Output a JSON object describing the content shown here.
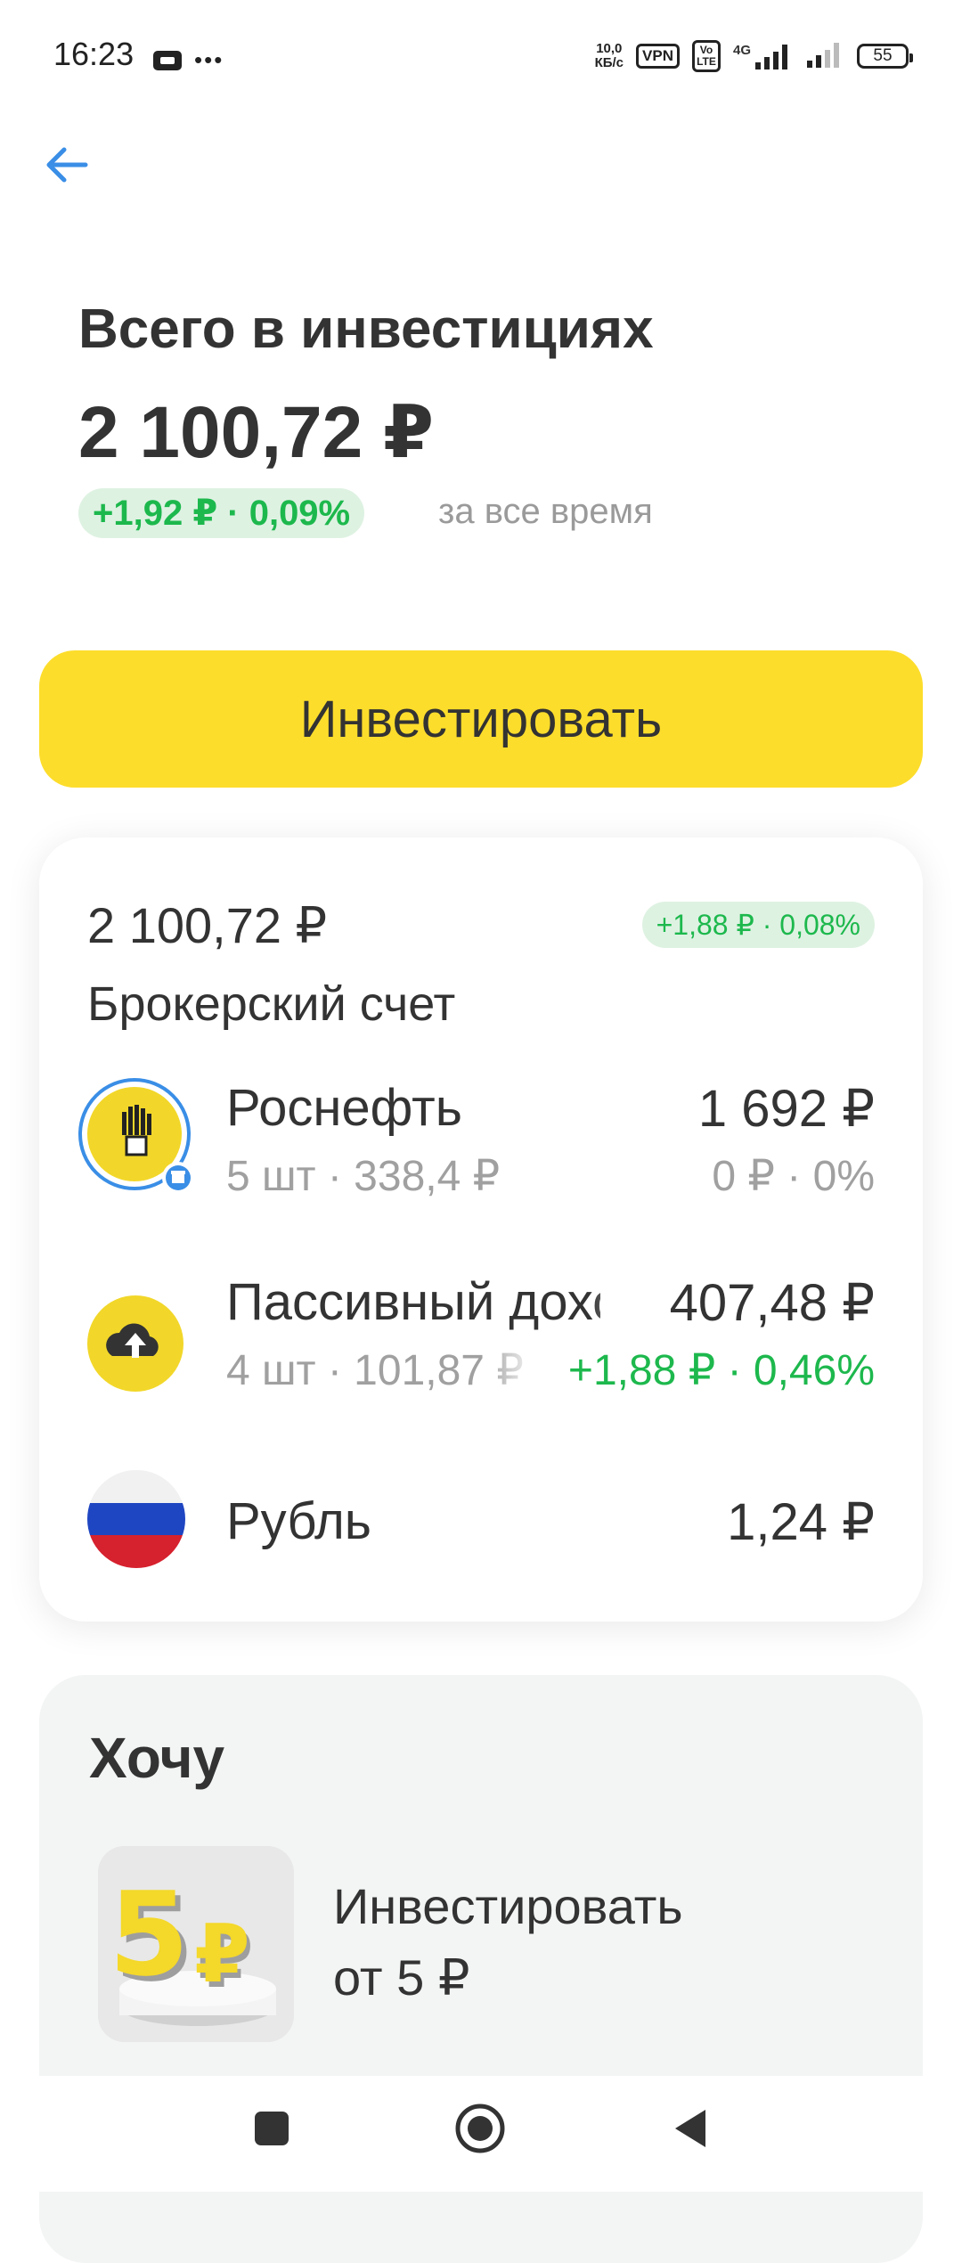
{
  "status_bar": {
    "time": "16:23",
    "dots": "•••",
    "speed_value": "10,0",
    "speed_unit": "КБ/с",
    "vpn": "VPN",
    "volte": "Vo LTE",
    "network": "4G",
    "battery": "55"
  },
  "header": {
    "title": "Всего в инвестициях",
    "total": "2 100,72 ₽",
    "gain_badge": "+1,92 ₽ · 0,09%",
    "gain_period": "за все время"
  },
  "actions": {
    "invest_label": "Инвестировать"
  },
  "account": {
    "amount": "2 100,72 ₽",
    "gain_badge": "+1,88 ₽ · 0,08%",
    "name": "Брокерский счет",
    "assets": [
      {
        "name": "Роснефть",
        "price": "1 692 ₽",
        "qty": "5 шт · 338,4 ₽",
        "change": "0 ₽ · 0%",
        "change_color": "#a0a0a0",
        "icon": "rosneft-logo-icon"
      },
      {
        "name": "Пассивный доход",
        "price": "407,48 ₽",
        "qty": "4 шт · 101,87 ₽",
        "change": "+1,88 ₽ · 0,46%",
        "change_color": "#1db84d",
        "icon": "passive-income-icon"
      },
      {
        "name": "Рубль",
        "price": "1,24 ₽",
        "icon": "russia-flag-icon"
      }
    ]
  },
  "want": {
    "title": "Хочу",
    "promo_line1": "Инвестировать",
    "promo_line2": "от 5 ₽",
    "promo_image_text": "5₽"
  },
  "colors": {
    "accent_yellow": "#fddd2b",
    "gain_green": "#1db84d",
    "back_arrow": "#3a8ee6"
  }
}
